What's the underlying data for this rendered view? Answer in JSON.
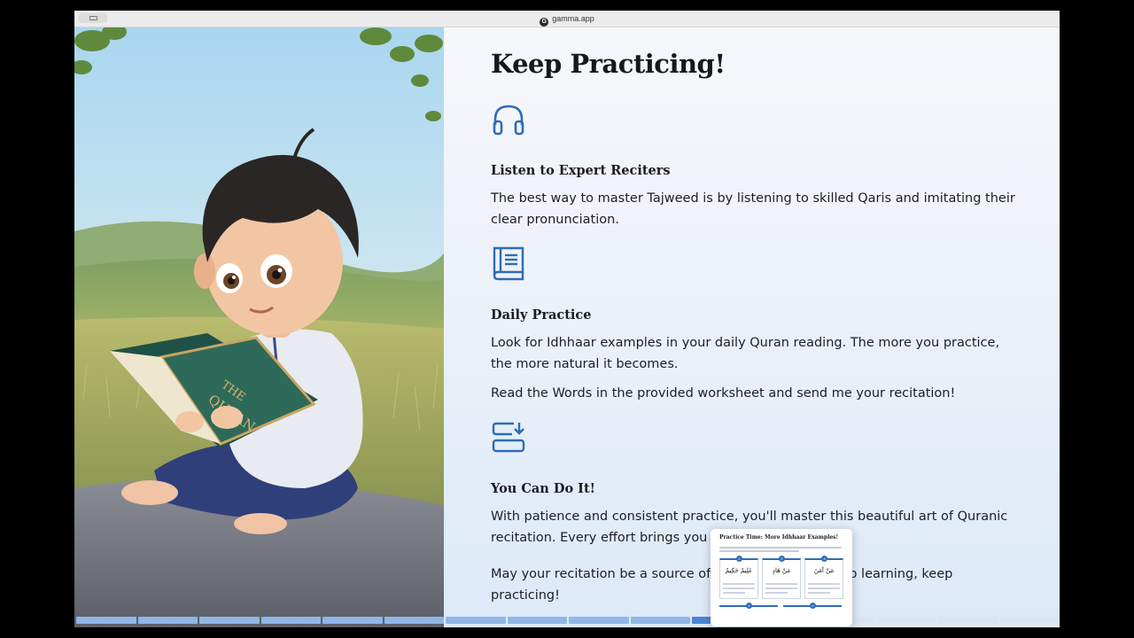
{
  "browser": {
    "url": "gamma.app",
    "favicon_letter": "G"
  },
  "slide": {
    "title": "Keep Practicing!",
    "features": [
      {
        "icon": "headphones-icon",
        "heading": "Listen to Expert Reciters",
        "paragraphs": [
          "The best way to master Tajweed is by listening to skilled Qaris and imitating their clear pronunciation."
        ]
      },
      {
        "icon": "book-icon",
        "heading": "Daily Practice",
        "paragraphs": [
          "Look for Idhhaar examples in your daily Quran reading. The more you practice, the more natural it becomes.",
          "Read the Words in the provided worksheet and send me your recitation!"
        ]
      },
      {
        "icon": "progress-icon",
        "heading": "You Can Do It!",
        "paragraphs": [
          "With patience and consistent practice, you'll master this beautiful art of Quranic recitation. Every effort brings you closer to excellence.",
          "May your recitation be a source of blessing for you. Keep learning, keep practicing!"
        ]
      }
    ]
  },
  "illustration": {
    "book_text_1": "THE",
    "book_text_2": "QURAN"
  },
  "thumbnail": {
    "title": "Practice Time: More Idhhaar Examples!",
    "cards": [
      {
        "number": "1",
        "arabic": "عَلِيمٌ حَكِيمٌ"
      },
      {
        "number": "2",
        "arabic": "مَنْ هَادٍ"
      },
      {
        "number": "3",
        "arabic": "مَنْ آمَنَ"
      }
    ],
    "cards_bottom": [
      {
        "number": "4"
      },
      {
        "number": "5"
      }
    ]
  },
  "progress": {
    "total_segments": 16,
    "current_segment": 11,
    "colors": {
      "done": "#8fb7e6",
      "current": "#4a86d6",
      "upcoming": "#d9e5f4"
    }
  },
  "colors": {
    "accent": "#2f6cb5",
    "title": "#17171f"
  }
}
